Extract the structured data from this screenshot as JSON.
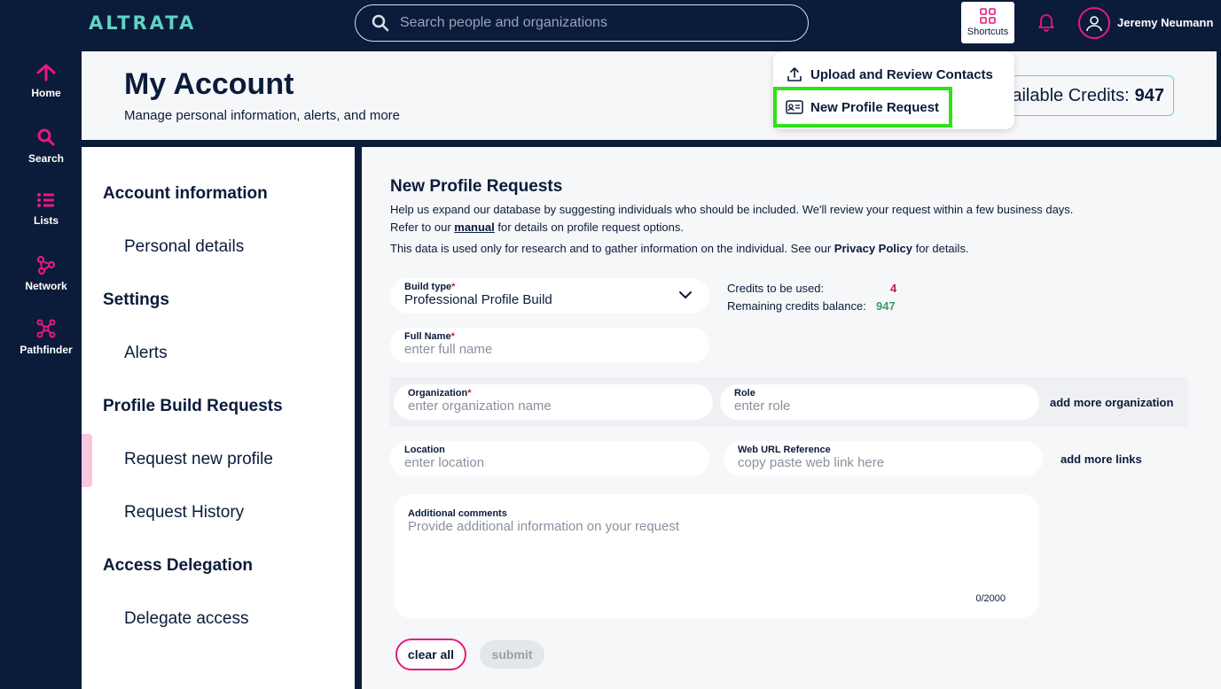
{
  "app": {
    "logo": "ALTRATA"
  },
  "search": {
    "placeholder": "Search people and organizations"
  },
  "topbar": {
    "shortcuts_label": "Shortcuts",
    "username": "Jeremy Neumann"
  },
  "nav": [
    {
      "label": "Home",
      "icon": "home-icon"
    },
    {
      "label": "Search",
      "icon": "search-icon"
    },
    {
      "label": "Lists",
      "icon": "list-icon"
    },
    {
      "label": "Network",
      "icon": "network-icon"
    },
    {
      "label": "Pathfinder",
      "icon": "pathfinder-icon"
    }
  ],
  "header": {
    "title": "My Account",
    "subtitle": "Manage personal information, alerts, and more",
    "credits_label": "Available Credits:",
    "credits_value": "947"
  },
  "shortcuts_menu": {
    "items": [
      {
        "label": "Upload and Review Contacts",
        "icon": "upload-icon"
      },
      {
        "label": "New Profile Request",
        "icon": "id-card-icon"
      }
    ]
  },
  "sidebar": {
    "sections": [
      {
        "title": "Account information",
        "items": [
          "Personal details"
        ]
      },
      {
        "title": "Settings",
        "items": [
          "Alerts"
        ]
      },
      {
        "title": "Profile Build Requests",
        "items": [
          "Request new profile",
          "Request History"
        ]
      },
      {
        "title": "Access Delegation",
        "items": [
          "Delegate access"
        ]
      }
    ]
  },
  "form": {
    "title": "New Profile Requests",
    "desc1": "Help us expand our database by suggesting individuals who should be included. We'll review your request within a few business days.",
    "desc2_pre": "Refer to our ",
    "desc2_link": "manual",
    "desc2_post": " for details on profile request options.",
    "desc3_pre": "This data is used only for research and to gather information on the individual. See our ",
    "desc3_link": "Privacy Policy",
    "desc3_post": " for details.",
    "build_type": {
      "label": "Build type",
      "value": "Professional Profile Build"
    },
    "credits_used_label": "Credits to be used:",
    "credits_used_value": "4",
    "remaining_label": "Remaining credits balance:",
    "remaining_value": "947",
    "full_name": {
      "label": "Full Name",
      "placeholder": "enter full name"
    },
    "organization": {
      "label": "Organization",
      "placeholder": "enter organization name"
    },
    "role": {
      "label": "Role",
      "placeholder": "enter role"
    },
    "add_org": "add more organization",
    "location": {
      "label": "Location",
      "placeholder": "enter location"
    },
    "web_url": {
      "label": "Web URL Reference",
      "placeholder": "copy paste web link here"
    },
    "add_links": "add more links",
    "comments": {
      "label": "Additional comments",
      "placeholder": "Provide additional information on your request",
      "counter": "0/2000"
    },
    "clear_label": "clear all",
    "submit_label": "submit"
  },
  "colors": {
    "navy": "#0b1b3a",
    "accent": "#e8197e",
    "teal": "#5ed4c4",
    "highlight": "#2fe01a",
    "credit_red": "#c2185b",
    "credit_green": "#3a9a6a"
  }
}
